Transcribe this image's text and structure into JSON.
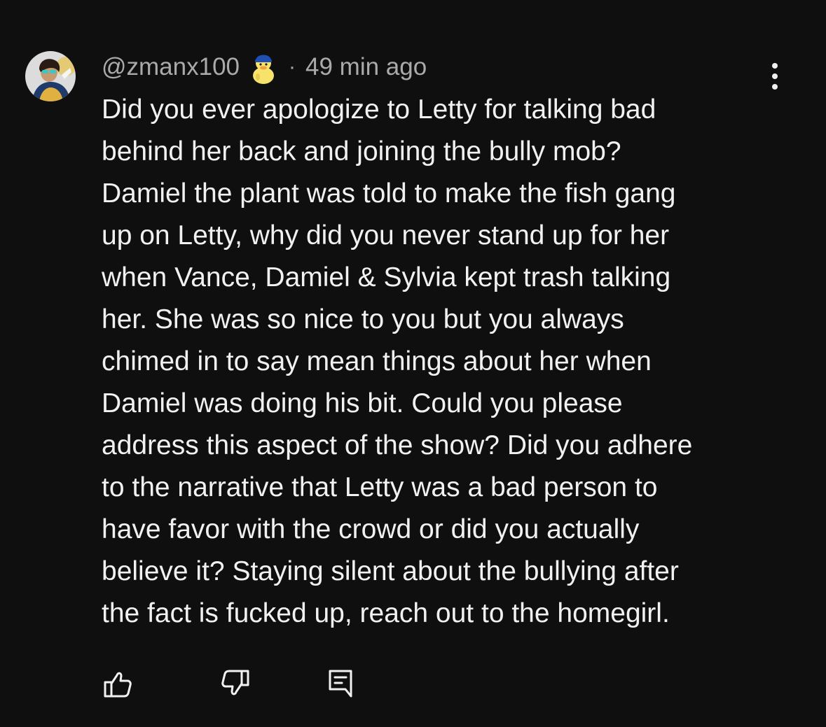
{
  "comment": {
    "handle": "@zmanx100",
    "separator": "·",
    "time": "49 min ago",
    "avatar_icon": "cartoon-character-avatar",
    "badge_icon": "yellow-duck-badge-icon",
    "body_lines": [
      "Did you ever apologize to Letty for talking bad",
      "behind her back and joining the bully mob?",
      "Damiel the plant was told to make the fish gang",
      "up on Letty, why did you never stand up for her",
      "when Vance, Damiel & Sylvia kept trash talking",
      "her. She was so nice to you but you always",
      "chimed in to say mean things about her when",
      "Damiel was doing his bit. Could you please",
      "address this aspect of the show? Did you adhere",
      "to the narrative that Letty was a bad person to",
      "have favor with the crowd or did you actually",
      "believe it? Staying silent about the bullying after",
      "the fact is fucked up, reach out to the homegirl."
    ]
  },
  "actions": {
    "like_icon": "thumbs-up-icon",
    "dislike_icon": "thumbs-down-icon",
    "reply_icon": "reply-icon",
    "more_icon": "more-vertical-icon"
  },
  "colors": {
    "background": "#0f0f0f",
    "text_primary": "#f1f1f1",
    "text_secondary": "#aaaaaa"
  }
}
